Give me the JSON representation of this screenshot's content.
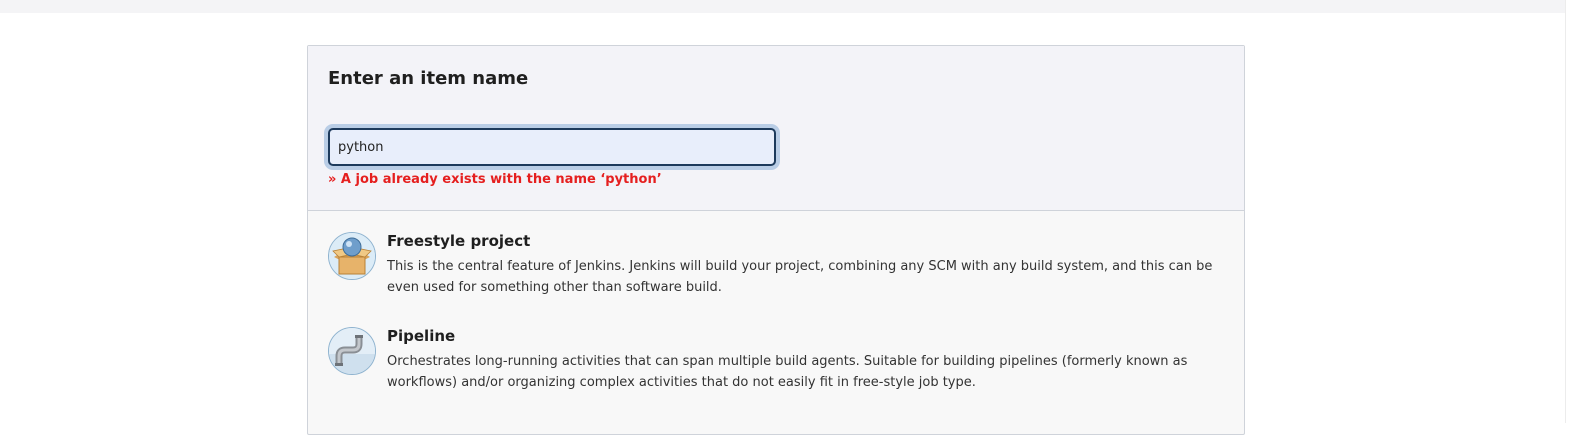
{
  "form": {
    "title": "Enter an item name",
    "item_name_value": "python",
    "error_message": "» A job already exists with the name ‘python’"
  },
  "item_types": [
    {
      "title": "Freestyle project",
      "description": "This is the central feature of Jenkins. Jenkins will build your project, combining any SCM with any build system, and this can be even used for something other than software build.",
      "icon": "freestyle-project-icon"
    },
    {
      "title": "Pipeline",
      "description": "Orchestrates long-running activities that can span multiple build agents. Suitable for building pipelines (formerly known as workflows) and/or organizing complex activities that do not easily fit in free-style job type.",
      "icon": "pipeline-icon"
    }
  ],
  "colors": {
    "error": "#e51f1f",
    "input_focus_border": "#1d3a5c"
  }
}
